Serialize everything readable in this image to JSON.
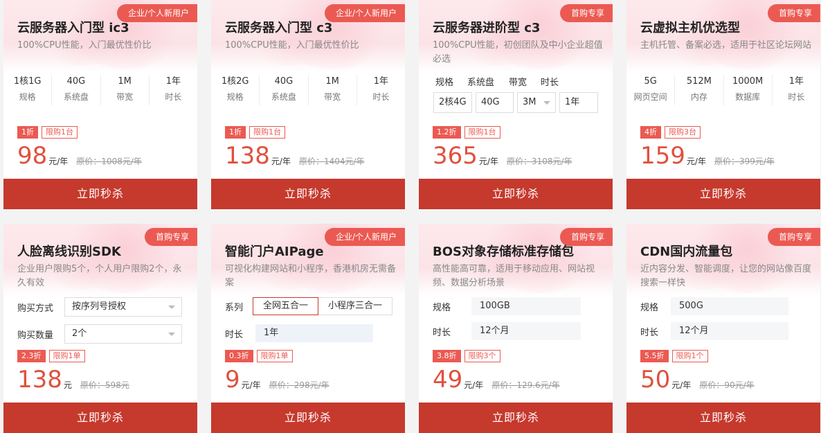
{
  "buy_label": "立即秒杀",
  "cards": [
    {
      "tag": "企业/个人新用户",
      "title": "云服务器入门型 ic3",
      "desc": "100%CPU性能，入门最优性价比",
      "specs": [
        {
          "v": "1核1G",
          "l": "规格"
        },
        {
          "v": "40G",
          "l": "系统盘"
        },
        {
          "v": "1M",
          "l": "带宽"
        },
        {
          "v": "1年",
          "l": "时长"
        }
      ],
      "discount": "1折",
      "limit": "限购1台",
      "price": "98",
      "unit": "元/年",
      "orig": "原价：1008元/年"
    },
    {
      "tag": "企业/个人新用户",
      "title": "云服务器入门型 c3",
      "desc": "100%CPU性能，入门最优性价比",
      "specs": [
        {
          "v": "1核2G",
          "l": "规格"
        },
        {
          "v": "40G",
          "l": "系统盘"
        },
        {
          "v": "1M",
          "l": "带宽"
        },
        {
          "v": "1年",
          "l": "时长"
        }
      ],
      "discount": "1折",
      "limit": "限购1台",
      "price": "138",
      "unit": "元/年",
      "orig": "原价：1404元/年"
    },
    {
      "tag": "首购专享",
      "title": "云服务器进阶型 c3",
      "desc": "100%CPU性能，初创团队及中小企业超值必选",
      "sel_labels": [
        "规格",
        "系统盘",
        "带宽",
        "时长"
      ],
      "sel_values": [
        "2核4G",
        "40G",
        "3M",
        "1年"
      ],
      "discount": "1.2折",
      "limit": "限购1台",
      "price": "365",
      "unit": "元/年",
      "orig": "原价：3108元/年"
    },
    {
      "tag": "首购专享",
      "title": "云虚拟主机优选型",
      "desc": "主机托管、备案必选，适用于社区论坛网站",
      "specs": [
        {
          "v": "5G",
          "l": "网页空间"
        },
        {
          "v": "512M",
          "l": "内存"
        },
        {
          "v": "1000M",
          "l": "数据库"
        },
        {
          "v": "1年",
          "l": "时长"
        }
      ],
      "discount": "4折",
      "limit": "限购3台",
      "price": "159",
      "unit": "元/年",
      "orig": "原价：399元/年"
    },
    {
      "tag": "首购专享",
      "title": "人脸离线识别SDK",
      "desc": "企业用户限购5个，个人用户限购2个，永久有效",
      "rows": [
        {
          "label": "购买方式",
          "value": "按序列号授权"
        },
        {
          "label": "购买数量",
          "value": "2个"
        }
      ],
      "discount": "2.3折",
      "limit": "限购1单",
      "price": "138",
      "unit": "元",
      "orig": "原价：598元"
    },
    {
      "tag": "企业/个人新用户",
      "title": "智能门户AIPage",
      "desc": "可视化构建网站和小程序，香港机房无需备案",
      "series_label": "系列",
      "options": [
        "全网五合一",
        "小程序三合一"
      ],
      "duration_label": "时长",
      "duration_value": "1年",
      "discount": "0.3折",
      "limit": "限购1单",
      "price": "9",
      "unit": "元/年",
      "orig": "原价：298元/年"
    },
    {
      "tag": "首购专享",
      "title": "BOS对象存储标准存储包",
      "desc": "高性能高可靠，适用于移动应用、网站视频、数据分析场景",
      "fields": [
        {
          "label": "规格",
          "value": "100GB"
        },
        {
          "label": "时长",
          "value": "12个月"
        }
      ],
      "discount": "3.8折",
      "limit": "限购3个",
      "price": "49",
      "unit": "元/年",
      "orig": "原价：129.6元/年"
    },
    {
      "tag": "首购专享",
      "title": "CDN国内流量包",
      "desc": "近内容分发、智能调度，让您的网站像百度搜索一样快",
      "fields": [
        {
          "label": "规格",
          "value": "500G"
        },
        {
          "label": "时长",
          "value": "12个月"
        }
      ],
      "discount": "5.5折",
      "limit": "限购1个",
      "price": "50",
      "unit": "元/年",
      "orig": "原价：90元/年"
    }
  ]
}
